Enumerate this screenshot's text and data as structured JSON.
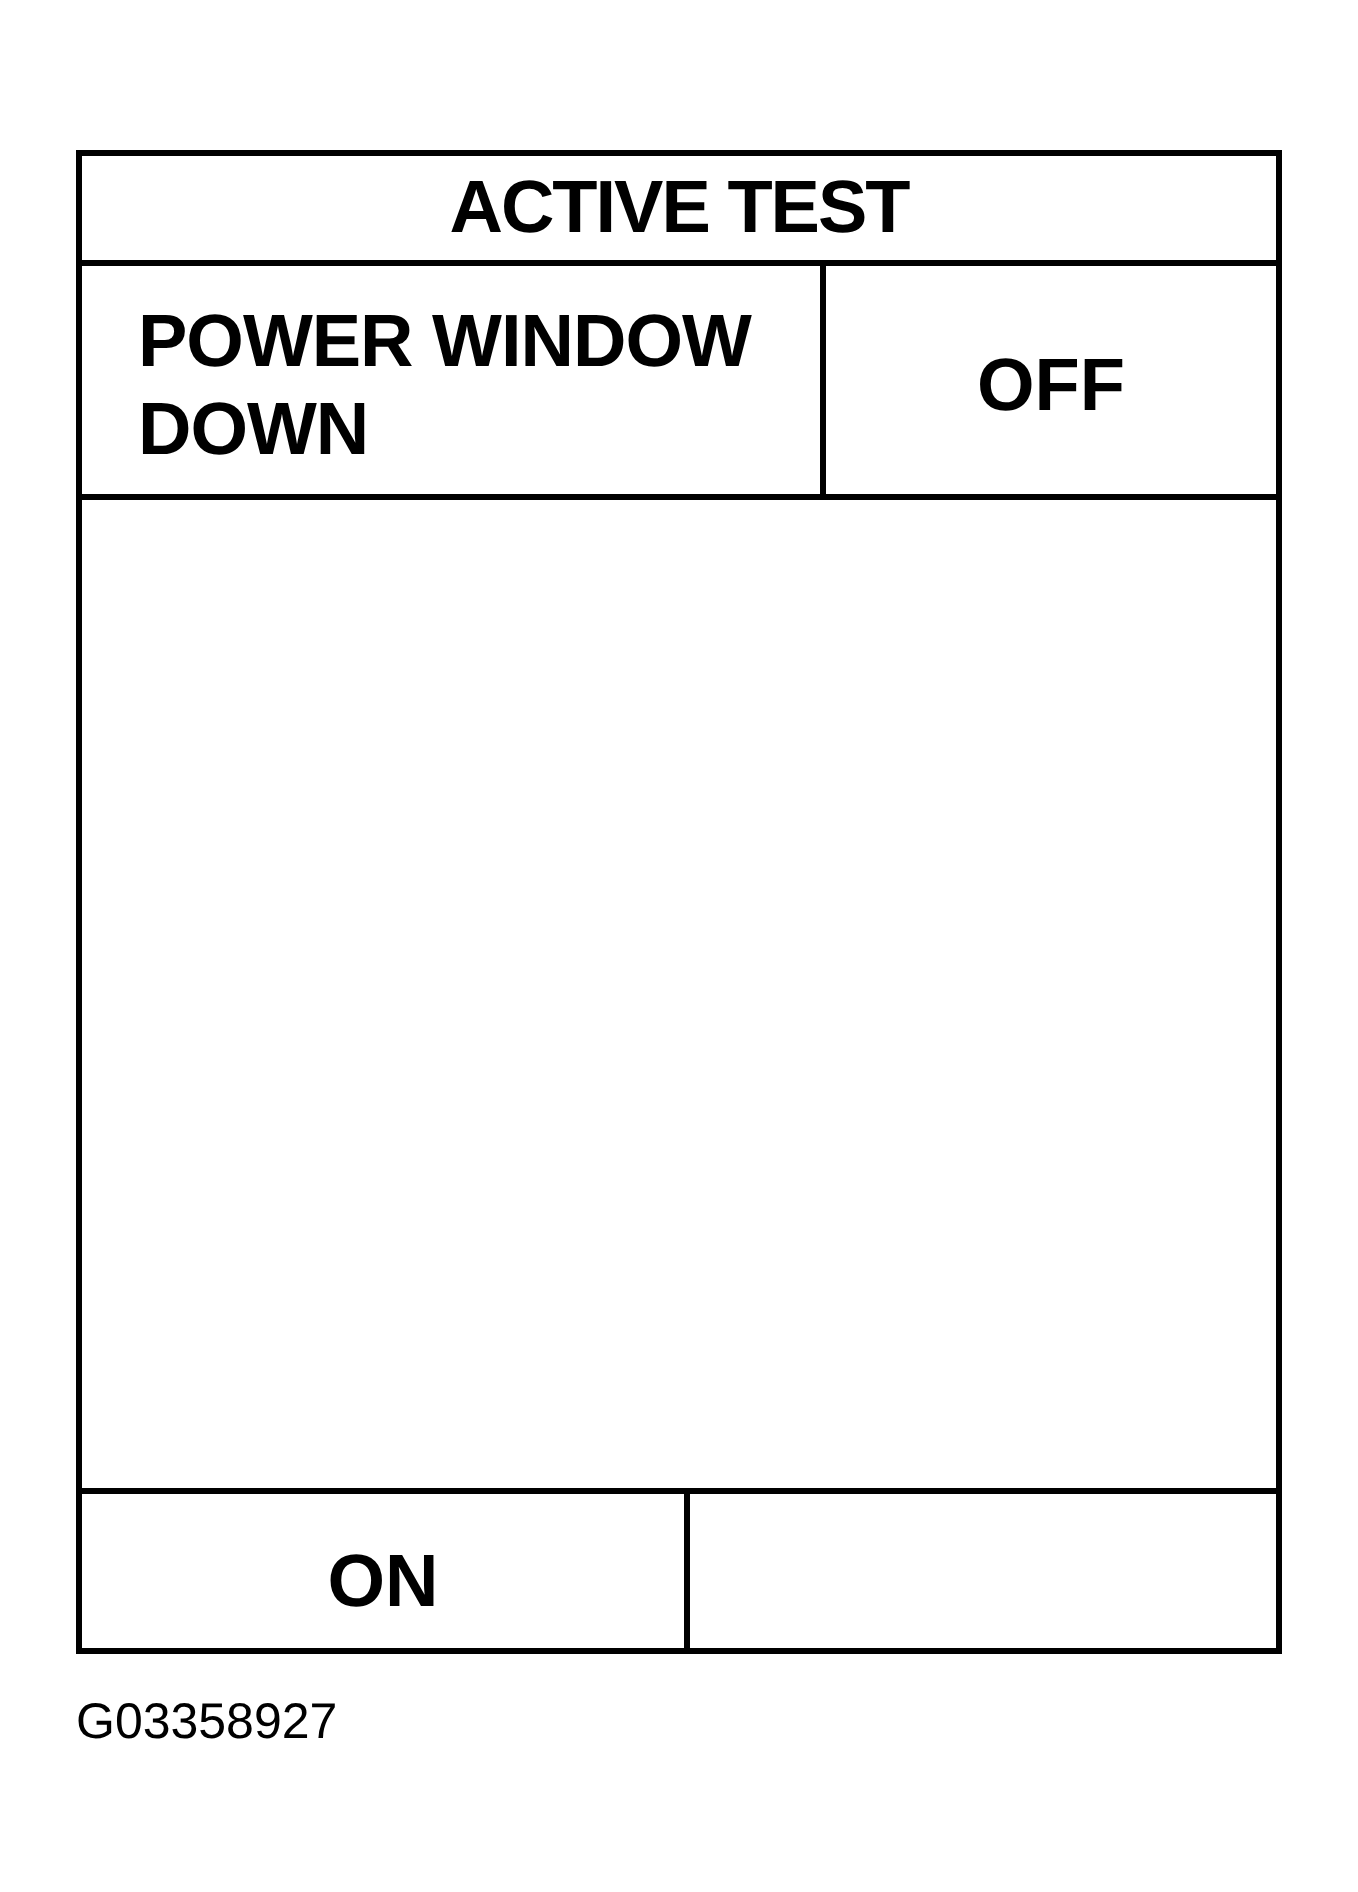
{
  "screen": {
    "title": "ACTIVE TEST",
    "item": {
      "label": "POWER WINDOW DOWN",
      "value": "OFF"
    },
    "softkeys": [
      {
        "label": "ON"
      }
    ]
  },
  "figure_id": "G03358927"
}
